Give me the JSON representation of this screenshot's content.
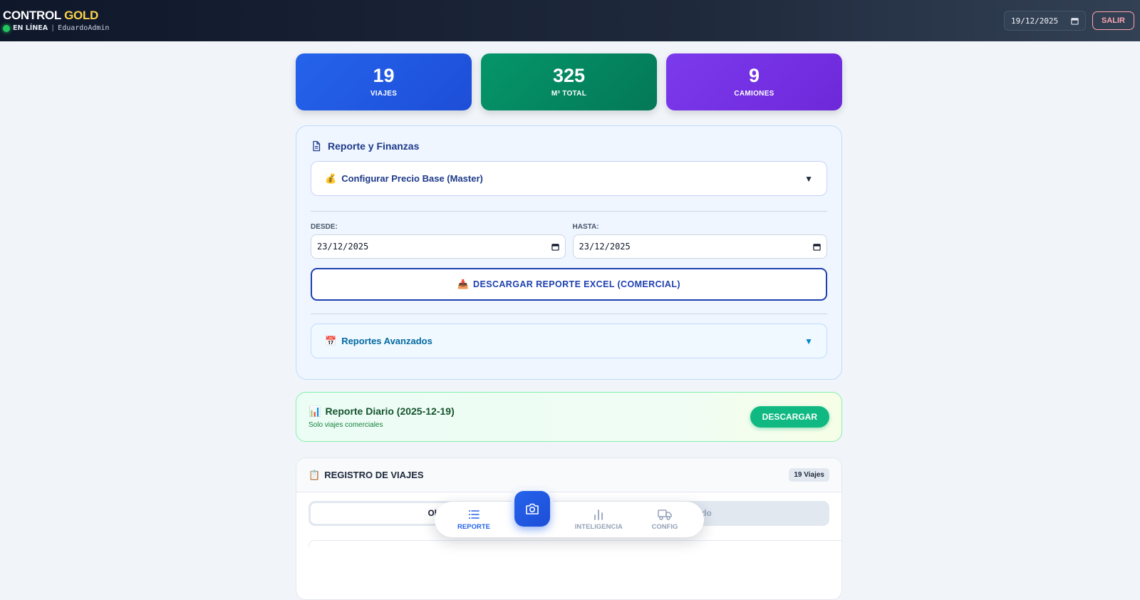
{
  "header": {
    "brand_part1": "CONTROL",
    "brand_part2": "GOLD",
    "status": "EN LÍNEA",
    "separator": "|",
    "user": "EduardoAdmin",
    "date": "19/12/2025",
    "logout_label": "SALIR"
  },
  "stats": [
    {
      "value": "19",
      "label": "VIAJES",
      "color": "#2563eb"
    },
    {
      "value": "325",
      "label": "M³ TOTAL",
      "color": "#059669"
    },
    {
      "value": "9",
      "label": "CAMIONES",
      "color": "#7c3aed"
    }
  ],
  "report_panel": {
    "title": "Reporte y Finanzas",
    "price_config": {
      "icon": "💰",
      "label": "Configurar Precio Base (Master)",
      "caret": "▼"
    },
    "from_label": "DESDE:",
    "from_value": "23/12/2025",
    "to_label": "HASTA:",
    "to_value": "23/12/2025",
    "excel_button": {
      "icon": "📥",
      "label": "DESCARGAR REPORTE EXCEL (COMERCIAL)"
    },
    "advanced": {
      "icon": "📅",
      "label": "Reportes Avanzados",
      "caret": "▼"
    }
  },
  "daily_report": {
    "icon": "📊",
    "title": "Reporte Diario (2025-12-19)",
    "subtitle": "Solo viajes comerciales",
    "button": "DESCARGAR"
  },
  "registry": {
    "icon": "📋",
    "title": "REGISTRO DE VIAJES",
    "badge": "19 Viajes",
    "tabs": [
      {
        "label": "Obras",
        "active": true
      },
      {
        "label": "s Ejido",
        "active": false
      }
    ]
  },
  "bottom_nav": {
    "items": [
      {
        "label": "REPORTE",
        "icon": "list-icon",
        "active": true
      },
      {
        "label": "INTELIGENCIA",
        "icon": "bar-chart-icon",
        "active": false
      },
      {
        "label": "CONFIG",
        "icon": "truck-icon",
        "active": false
      }
    ],
    "center_action": "camera-icon"
  }
}
